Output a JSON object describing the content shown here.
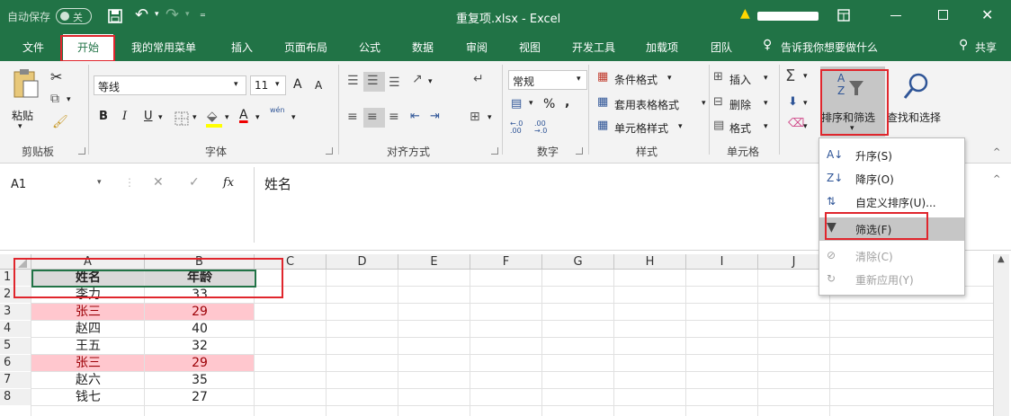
{
  "titlebar": {
    "autosave": "自动保存",
    "autosave_state": "关",
    "window_title": "重复项.xlsx - Excel"
  },
  "tabs": [
    "文件",
    "开始",
    "我的常用菜单",
    "插入",
    "页面布局",
    "公式",
    "数据",
    "审阅",
    "视图",
    "开发工具",
    "加载项",
    "团队"
  ],
  "tell_me": "告诉我你想要做什么",
  "share": "共享",
  "ribbon": {
    "clipboard": {
      "paste": "粘贴",
      "label": "剪贴板"
    },
    "font": {
      "name": "等线",
      "size": "11",
      "label": "字体",
      "bold": "B",
      "italic": "I",
      "underline": "U",
      "grow": "A",
      "shrink": "A",
      "font_color": "A",
      "phonetic": "wén"
    },
    "alignment": {
      "label": "对齐方式"
    },
    "number": {
      "format": "常规",
      "percent": "%",
      "comma": ",",
      "label": "数字",
      "dec_inc": "←.0 .00",
      "dec_dec": ".00 →.0"
    },
    "styles": {
      "cond": "条件格式",
      "table": "套用表格格式",
      "cell": "单元格样式",
      "label": "样式"
    },
    "cells": {
      "insert": "插入",
      "delete": "删除",
      "format": "格式",
      "label": "单元格"
    },
    "editing": {
      "sort_filter": "排序和筛选",
      "find_select": "查找和选择"
    }
  },
  "formula_bar": {
    "name_box": "A1",
    "fx": "fx",
    "content": "姓名"
  },
  "sort_menu": {
    "items": [
      {
        "label": "升序(S)",
        "enabled": true
      },
      {
        "label": "降序(O)",
        "enabled": true
      },
      {
        "label": "自定义排序(U)...",
        "enabled": true
      },
      {
        "label": "筛选(F)",
        "enabled": true,
        "highlighted": true
      },
      {
        "label": "清除(C)",
        "enabled": false
      },
      {
        "label": "重新应用(Y)",
        "enabled": false
      }
    ]
  },
  "sheet": {
    "columns": [
      "A",
      "B",
      "C",
      "D",
      "E",
      "F",
      "G",
      "H",
      "I",
      "J"
    ],
    "rows": [
      {
        "num": "1",
        "name": "姓名",
        "age": "年龄",
        "header": true
      },
      {
        "num": "2",
        "name": "李力",
        "age": "33"
      },
      {
        "num": "3",
        "name": "张三",
        "age": "29",
        "dup": true
      },
      {
        "num": "4",
        "name": "赵四",
        "age": "40"
      },
      {
        "num": "5",
        "name": "王五",
        "age": "32"
      },
      {
        "num": "6",
        "name": "张三",
        "age": "29",
        "dup": true
      },
      {
        "num": "7",
        "name": "赵六",
        "age": "35"
      },
      {
        "num": "8",
        "name": "钱七",
        "age": "27"
      }
    ]
  },
  "colors": {
    "excel_green": "#217346",
    "highlight_red": "#e0262d",
    "dup_fill": "#ffc7ce",
    "dup_text": "#9c0006",
    "header_fill": "#d9d9d9"
  }
}
